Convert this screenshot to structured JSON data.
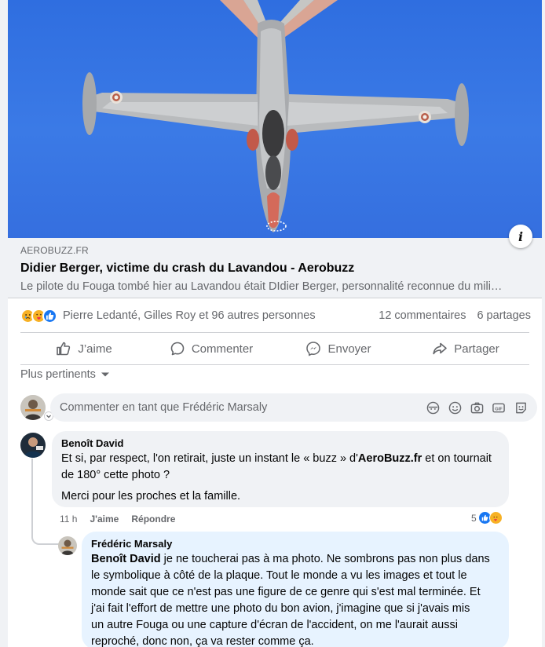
{
  "link_preview": {
    "domain": "AEROBUZZ.FR",
    "title": "Didier Berger, victime du crash du Lavandou - Aerobuzz",
    "description": "Le pilote du Fouga tombé hier au Lavandou était DIdier Berger, personnalité reconnue du mili…",
    "info_label": "i"
  },
  "reactions": {
    "icons": [
      "sad",
      "care",
      "like"
    ],
    "names": "Pierre Ledanté, Gilles Roy et 96 autres personnes",
    "comments": "12 commentaires",
    "shares": "6 partages"
  },
  "actions": {
    "like": "J’aime",
    "comment": "Commenter",
    "send": "Envoyer",
    "share": "Partager"
  },
  "sort": {
    "label": "Plus pertinents"
  },
  "composer": {
    "placeholder": "Commenter en tant que Frédéric Marsaly",
    "tools": [
      "avatar-sticker-icon",
      "emoji-icon",
      "camera-icon",
      "gif-icon",
      "sticker-icon"
    ]
  },
  "comments": [
    {
      "author": "Benoît David",
      "text_line1": "Et si, par respect, l'on retirait, juste un instant le « buzz » d'",
      "text_mention": "AeroBuzz.fr",
      "text_line1_end": " et on tournait",
      "text_line2": "de 180° cette photo ?",
      "text_para2": "Merci pour les proches et la famille.",
      "time": "11 h",
      "like": "J'aime",
      "reply": "Répondre",
      "reaction_count": "5"
    },
    {
      "author": "Frédéric Marsaly",
      "mention": "Benoît David",
      "line1": " je ne toucherai pas à ma photo. Ne sombrons pas non plus dans",
      "line2": "le symbolique à côté de la plaque. Tout le monde a vu les images et tout le",
      "line3": "monde sait que ce n'est pas une figure de ce genre qui s'est mal terminée. Et",
      "line4": "j'ai fait l'effort de mettre une photo du bon avion, j'imagine que si j'avais mis",
      "line5": "un autre Fouga ou une capture d'écran de l'accident, on me l'aurait aussi",
      "line6": "reproché, donc non, ça va rester comme ça."
    }
  ],
  "colors": {
    "sky": "#3b7ae6",
    "like_blue": "#1877f2",
    "secondary_text": "#65676b",
    "bubble_bg": "#f0f2f5",
    "reply_bubble_bg": "#e7f3ff"
  }
}
